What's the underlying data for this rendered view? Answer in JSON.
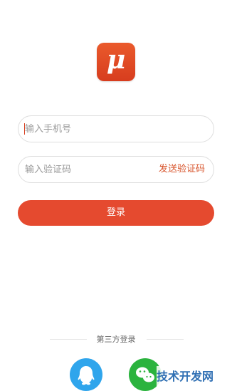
{
  "app": {
    "logo_letter": "μ"
  },
  "form": {
    "phone_placeholder": "输入手机号",
    "code_placeholder": "输入验证码",
    "send_code_label": "发送验证码",
    "login_label": "登录"
  },
  "third_party": {
    "label": "第三方登录",
    "providers": [
      "QQ",
      "微信"
    ]
  },
  "watermark": {
    "text": "技术开发网"
  },
  "colors": {
    "brand": "#e54a2f",
    "qq": "#2fa5ec",
    "wechat": "#2bb33e"
  }
}
